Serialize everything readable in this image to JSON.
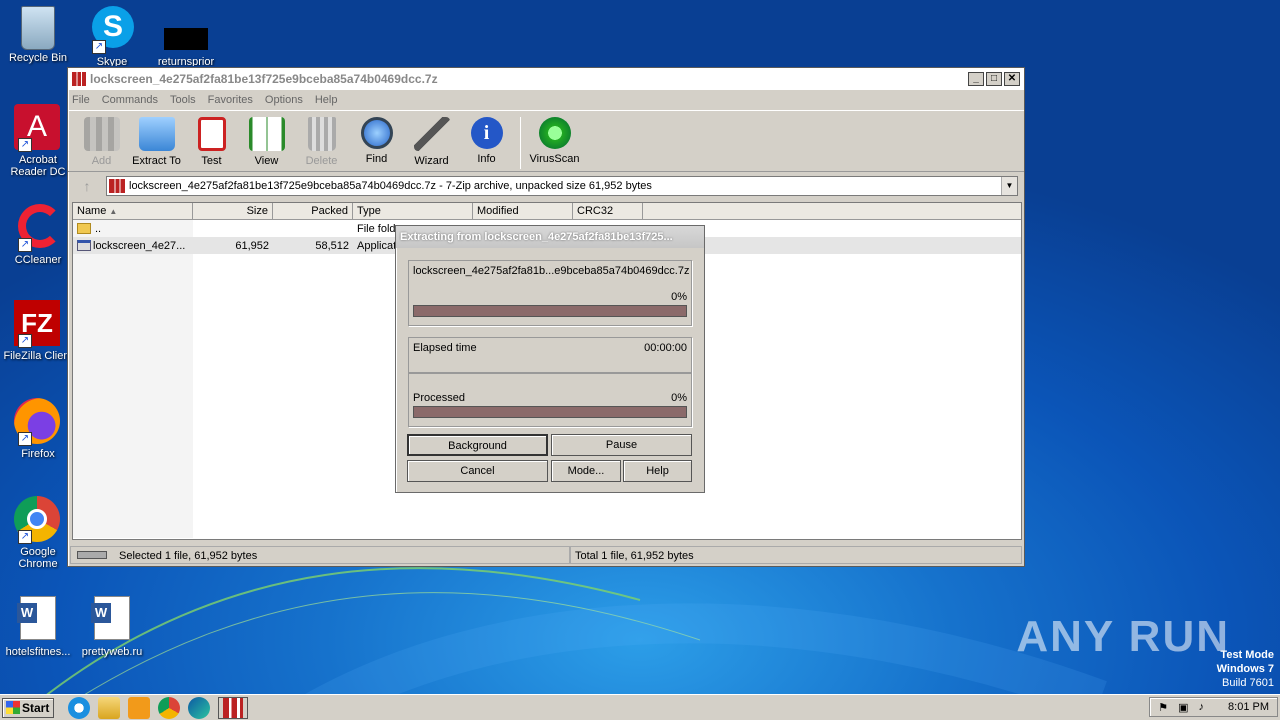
{
  "desktop": {
    "icons": [
      {
        "label": "Recycle Bin",
        "icon": "recycle-bin-icon"
      },
      {
        "label": "Skype",
        "icon": "skype-icon"
      },
      {
        "label": "returnsprior",
        "icon": "black-file-icon"
      },
      {
        "label": "Acrobat Reader DC",
        "icon": "acrobat-icon"
      },
      {
        "label": "CCleaner",
        "icon": "ccleaner-icon"
      },
      {
        "label": "FileZilla Client",
        "icon": "filezilla-icon"
      },
      {
        "label": "Firefox",
        "icon": "firefox-icon"
      },
      {
        "label": "Google Chrome",
        "icon": "chrome-icon"
      },
      {
        "label": "hotelsfitnes...",
        "icon": "word-doc-icon"
      },
      {
        "label": "prettyweb.ru",
        "icon": "word-doc-icon"
      }
    ],
    "watermark": "ANY RUN",
    "test_mode": {
      "line1": "Test Mode",
      "line2": "Windows 7",
      "line3": "Build 7601"
    }
  },
  "window": {
    "title": "lockscreen_4e275af2fa81be13f725e9bceba85a74b0469dcc.7z",
    "controls": {
      "minimize": "_",
      "maximize": "□",
      "close": "✕"
    },
    "menu": [
      "File",
      "Commands",
      "Tools",
      "Favorites",
      "Options",
      "Help"
    ],
    "toolbar": [
      {
        "label": "Add",
        "icon": "add-archive-icon",
        "disabled": true
      },
      {
        "label": "Extract To",
        "icon": "extract-folder-icon",
        "disabled": false
      },
      {
        "label": "Test",
        "icon": "test-clipboard-icon",
        "disabled": false
      },
      {
        "label": "View",
        "icon": "view-book-icon",
        "disabled": false
      },
      {
        "label": "Delete",
        "icon": "delete-trash-icon",
        "disabled": true
      },
      {
        "label": "Find",
        "icon": "find-magnifier-icon",
        "disabled": false
      },
      {
        "label": "Wizard",
        "icon": "wizard-wand-icon",
        "disabled": false
      },
      {
        "label": "Info",
        "icon": "info-icon",
        "disabled": false
      },
      {
        "label": "VirusScan",
        "icon": "virusscan-bug-icon",
        "disabled": false
      }
    ],
    "address": "lockscreen_4e275af2fa81be13f725e9bceba85a74b0469dcc.7z - 7-Zip archive, unpacked size 61,952 bytes",
    "columns": [
      "Name",
      "Size",
      "Packed",
      "Type",
      "Modified",
      "CRC32"
    ],
    "rows": [
      {
        "name": "..",
        "size": "",
        "packed": "",
        "type": "File fold"
      },
      {
        "name": "lockscreen_4e27...",
        "size": "61,952",
        "packed": "58,512",
        "type": "Applicat"
      }
    ],
    "status_left": "Selected 1 file, 61,952 bytes",
    "status_right": "Total 1 file, 61,952 bytes"
  },
  "progress_dialog": {
    "title": "Extracting from lockscreen_4e275af2fa81be13f725...",
    "file": "lockscreen_4e275af2fa81b...e9bceba85a74b0469dcc.7z",
    "file_percent": "0%",
    "file_progress": 0,
    "elapsed_label": "Elapsed time",
    "elapsed_value": "00:00:00",
    "processed_label": "Processed",
    "processed_percent": "0%",
    "processed_progress": 0,
    "buttons": {
      "background": "Background",
      "pause": "Pause",
      "cancel": "Cancel",
      "mode": "Mode...",
      "help": "Help"
    }
  },
  "taskbar": {
    "start": "Start",
    "clock": "8:01 PM"
  },
  "colors": {
    "progress_fill": "#8b6a6a",
    "desktop_blue": "#0b55b8"
  }
}
